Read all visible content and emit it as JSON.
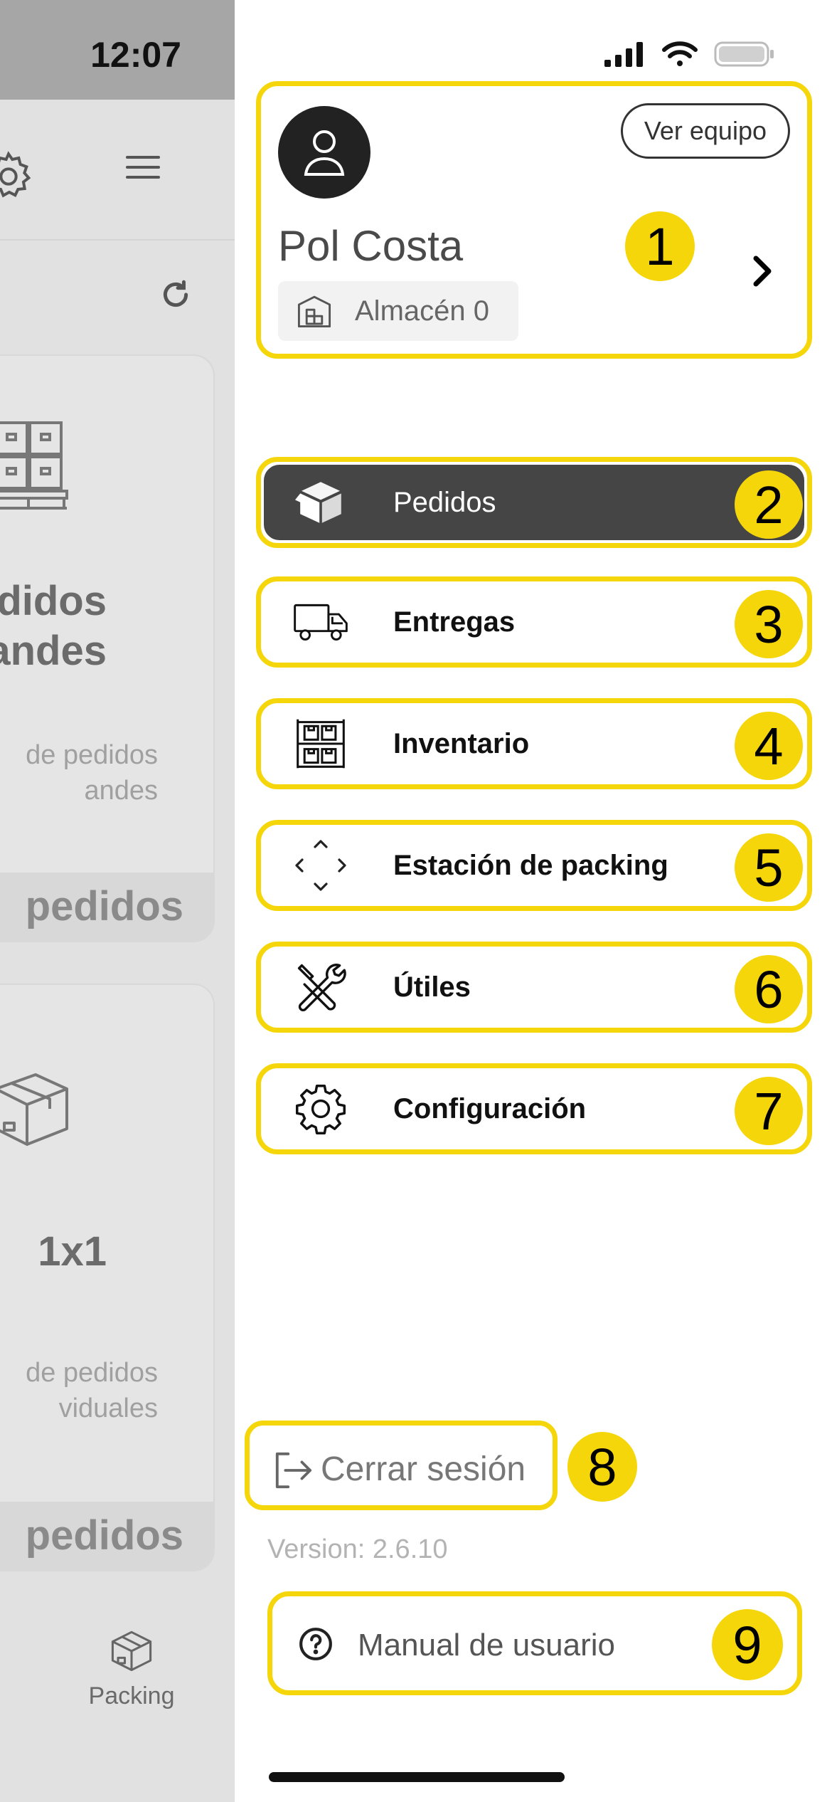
{
  "status_bar": {
    "time": "12:07"
  },
  "background_app": {
    "card_1": {
      "title_lines": [
        "didos",
        "andes"
      ],
      "desc_lines": [
        "de pedidos",
        "andes"
      ],
      "button_label": "pedidos"
    },
    "card_2": {
      "title_lines": [
        "1x1"
      ],
      "desc_lines": [
        "de pedidos",
        "viduales"
      ],
      "button_label": "pedidos"
    },
    "tab": {
      "label": "Packing"
    }
  },
  "profile": {
    "name": "Pol Costa",
    "warehouse": "Almacén 0",
    "view_team_label": "Ver equipo",
    "marker": "1"
  },
  "menu": [
    {
      "label": "Pedidos",
      "icon": "box-open-icon",
      "marker": "2",
      "active": true
    },
    {
      "label": "Entregas",
      "icon": "truck-icon",
      "marker": "3"
    },
    {
      "label": "Inventario",
      "icon": "shelving-icon",
      "marker": "4"
    },
    {
      "label": "Estación de packing",
      "icon": "directions-icon",
      "marker": "5"
    },
    {
      "label": "Útiles",
      "icon": "tools-icon",
      "marker": "6"
    },
    {
      "label": "Configuración",
      "icon": "gear-icon",
      "marker": "7"
    }
  ],
  "logout": {
    "label": "Cerrar sesión",
    "marker": "8"
  },
  "version": "Version: 2.6.10",
  "manual": {
    "label": "Manual de usuario",
    "marker": "9"
  },
  "colors": {
    "highlight": "#f5d60a",
    "active_item": "#454545",
    "dim_panel": "#e1e1e1"
  }
}
